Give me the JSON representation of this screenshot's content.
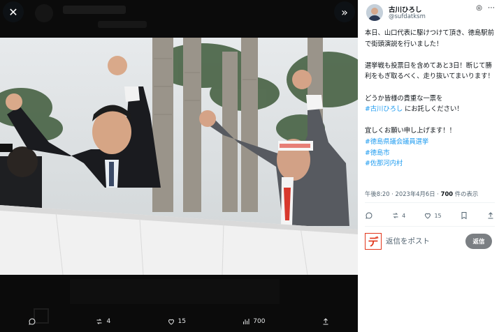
{
  "viewer": {
    "actions": {
      "replies": "",
      "reposts": "4",
      "likes": "15",
      "views": "700"
    }
  },
  "tweet": {
    "name": "古川ひろし",
    "handle": "@sufdatksm",
    "text_p1": "本日、山口代表に駆けつけて頂き、徳島駅前で街頭演説を行いました！",
    "text_p2": "選挙戦も投票日を含めてあと3日！断じて勝利をもぎ取るべく、走り抜いてまいります！",
    "text_p3_before": "どうか皆様の貴重な一票を",
    "text_p3_link": "#古川ひろし",
    "text_p3_after": " にお託しください！",
    "text_p4": "宜しくお願い申し上げます！！",
    "hashtags": [
      "#徳島県議会議員選挙",
      "#徳島市",
      "#佐那河内村"
    ],
    "meta_time": "午後8:20 · 2023年4月6日 · ",
    "meta_views": "700",
    "meta_views_suffix": " 件の表示",
    "stats": {
      "reposts": "4",
      "likes": "15"
    }
  },
  "reply": {
    "logo_char": "デ",
    "placeholder": "返信をポスト",
    "button": "返信"
  },
  "colors": {
    "link": "#1d9bf0",
    "reply_logo": "#e2361b",
    "muted": "#536471"
  }
}
